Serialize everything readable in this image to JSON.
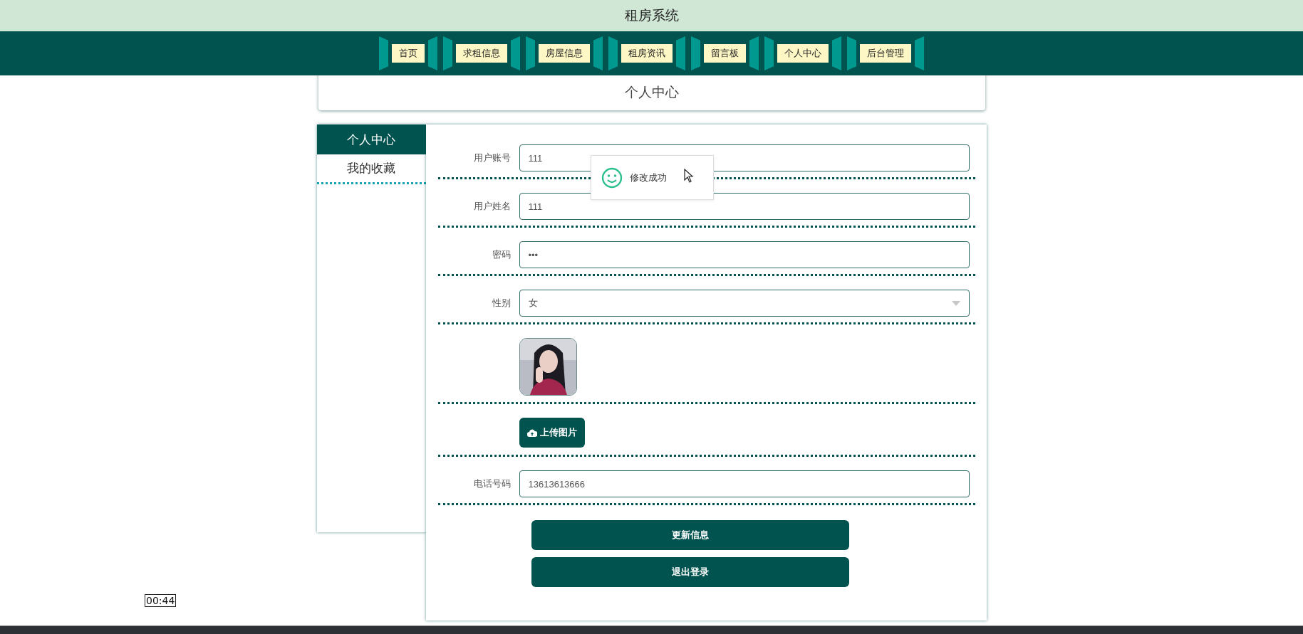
{
  "app_title": "租房系统",
  "nav": [
    {
      "label": "首页"
    },
    {
      "label": "求租信息"
    },
    {
      "label": "房屋信息"
    },
    {
      "label": "租房资讯"
    },
    {
      "label": "留言板"
    },
    {
      "label": "个人中心"
    },
    {
      "label": "后台管理"
    }
  ],
  "header": {
    "title": "个人中心"
  },
  "sidebar": [
    {
      "label": "个人中心",
      "selected": true
    },
    {
      "label": "我的收藏",
      "selected": false
    }
  ],
  "form": {
    "fields": [
      {
        "kind": "text",
        "label": "用户账号",
        "value": "111"
      },
      {
        "kind": "text",
        "label": "用户姓名",
        "value": "111"
      },
      {
        "kind": "text",
        "label": "密码",
        "value": "•••"
      },
      {
        "kind": "select",
        "label": "性别",
        "value": "女"
      },
      {
        "kind": "avatar"
      },
      {
        "kind": "upload",
        "button": "上传图片"
      },
      {
        "kind": "text",
        "label": "电话号码",
        "value": "13613613666"
      }
    ],
    "buttons": [
      "更新信息",
      "退出登录"
    ]
  },
  "toast": {
    "message": "修改成功"
  },
  "time_tooltip": "00:44"
}
